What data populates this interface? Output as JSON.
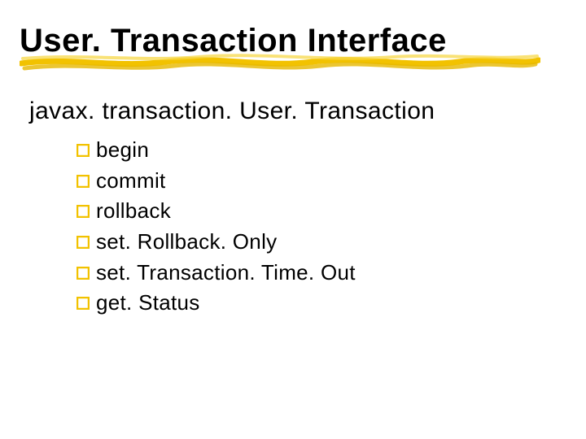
{
  "title": "User. Transaction Interface",
  "subheading": "javax. transaction. User. Transaction",
  "bullets": [
    "begin",
    "commit",
    "rollback",
    "set. Rollback. Only",
    "set. Transaction. Time. Out",
    "get. Status"
  ],
  "colors": {
    "accent": "#f2c200",
    "accent_dark": "#d9a400"
  }
}
